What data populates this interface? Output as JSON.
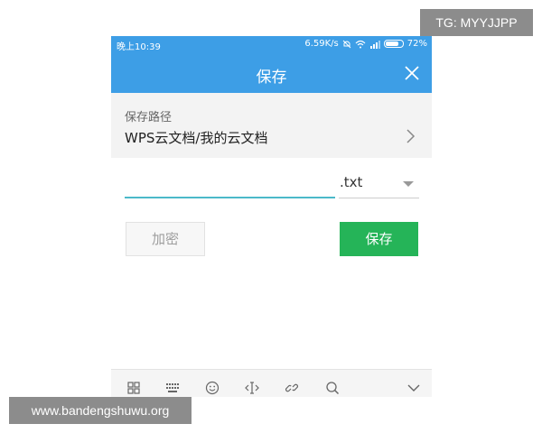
{
  "statusbar": {
    "time": "晚上10:39",
    "speed": "6.59K/s",
    "battery": "72%"
  },
  "dialog": {
    "title": "保存"
  },
  "path": {
    "label": "保存路径",
    "value": "WPS云文档/我的云文档"
  },
  "filename": {
    "value": "",
    "extension": ".txt"
  },
  "buttons": {
    "encrypt": "加密",
    "save": "保存"
  },
  "keyboard_toolbar": {
    "icons": [
      "grid-icon",
      "keyboard-icon",
      "emoji-icon",
      "cursor-icon",
      "link-icon",
      "search-icon",
      "chevron-down-icon"
    ]
  },
  "watermarks": {
    "tg": "TG: MYYJJPP",
    "site": "www.bandengshuwu.org"
  },
  "colors": {
    "header": "#3d9ee6",
    "save_button": "#25b458",
    "input_underline": "#4bb9c9"
  }
}
